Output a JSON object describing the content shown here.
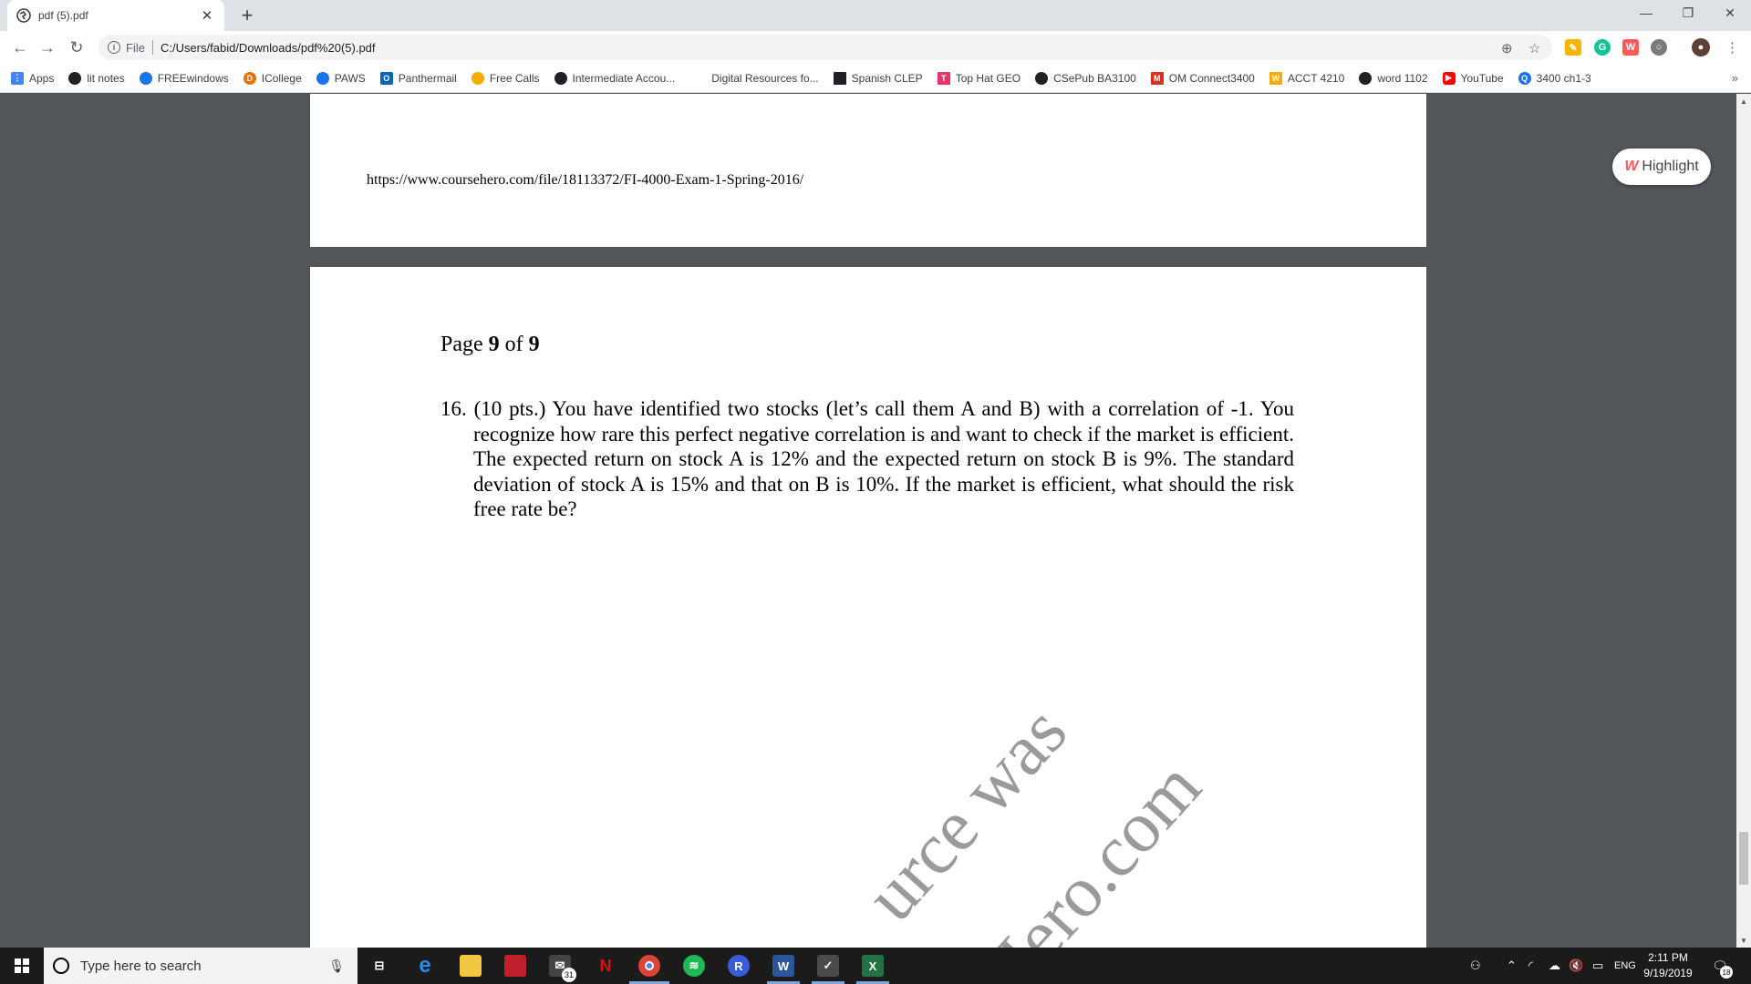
{
  "tab": {
    "title": "pdf (5).pdf"
  },
  "address": {
    "scheme_label": "File",
    "url": "C:/Users/fabid/Downloads/pdf%20(5).pdf"
  },
  "bookmarks": [
    {
      "label": "Apps",
      "color": "#4285f4"
    },
    {
      "label": "lit notes",
      "color": "#202124"
    },
    {
      "label": "FREEwindows",
      "color": "#1a73e8"
    },
    {
      "label": "ICollege",
      "color": "#e8710a"
    },
    {
      "label": "PAWS",
      "color": "#1a73e8"
    },
    {
      "label": "Panthermail",
      "color": "#0364b8"
    },
    {
      "label": "Free Calls",
      "color": "#f9ab00"
    },
    {
      "label": "Intermediate Accou...",
      "color": "#202124"
    },
    {
      "label": "Digital Resources fo...",
      "color": "#ffffff"
    },
    {
      "label": "Spanish CLEP",
      "color": "#202124"
    },
    {
      "label": "Top Hat GEO",
      "color": "#e8336b"
    },
    {
      "label": "CSePub BA3100",
      "color": "#202124"
    },
    {
      "label": "OM Connect3400",
      "color": "#d93025"
    },
    {
      "label": "ACCT 4210",
      "color": "#f9ab00"
    },
    {
      "label": "word 1102",
      "color": "#202124"
    },
    {
      "label": "YouTube",
      "color": "#ff0000"
    },
    {
      "label": "3400 ch1-3",
      "color": "#1a73e8"
    }
  ],
  "bookmarks_more": "»",
  "pdf": {
    "prev_page_url": "https://www.coursehero.com/file/18113372/FI-4000-Exam-1-Spring-2016/",
    "page_label_prefix": "Page ",
    "page_current": "9",
    "page_label_mid": " of ",
    "page_total": "9",
    "question": "16. (10 pts.) You have identified two stocks (let’s call them A and B) with a correlation of -1. You recognize how rare this perfect negative correlation is and want to check if the market is efficient. The expected return on stock A is 12% and the expected return on stock B is 9%. The standard deviation of stock A is 15% and that on B is 10%. If the market is efficient, what should the risk free rate be?",
    "watermark_line1": "urce was",
    "watermark_line2": "Hero.com"
  },
  "highlight_button": {
    "label": "Highlight"
  },
  "taskbar": {
    "search_placeholder": "Type here to search",
    "mail_badge": "31",
    "language": "ENG",
    "time": "2:11 PM",
    "date": "9/19/2019",
    "notification_count": "18"
  }
}
